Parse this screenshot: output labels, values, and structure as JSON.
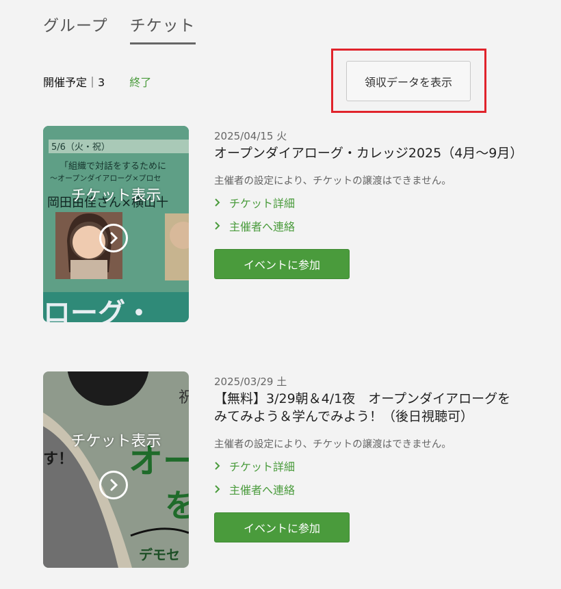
{
  "tabs": [
    {
      "label": "グループ"
    },
    {
      "label": "チケット"
    }
  ],
  "filters": {
    "upcoming": "開催予定｜3",
    "ended": "終了"
  },
  "receipt_button": "領収データを表示",
  "events": [
    {
      "thumb_label": "チケット表示",
      "thumb_text": {
        "date_banner": "5/6（火・祝）",
        "line1": "「組織で対話をするために",
        "line2": "～オープンダイアローグ×プロセ",
        "names": "岡田由佳さん×横山十",
        "bottom": "ローグ・"
      },
      "date": "2025/04/15 火",
      "title": "オープンダイアローグ・カレッジ2025（4月～9月）",
      "note": "主催者の設定により、チケットの譲渡はできません。",
      "link_detail": "チケット詳細",
      "link_contact": "主催者へ連絡",
      "join": "イベントに参加"
    },
    {
      "thumb_label": "チケット表示",
      "thumb_text": {
        "top_char": "祝",
        "big1": "オー",
        "big2": "を",
        "excl": "す！",
        "bottom": "デモセ"
      },
      "date": "2025/03/29 土",
      "title": "【無料】3/29朝＆4/1夜　オープンダイアローグをみてみよう＆学んでみよう！（後日視聴可）",
      "note": "主催者の設定により、チケットの譲渡はできません。",
      "link_detail": "チケット詳細",
      "link_contact": "主催者へ連絡",
      "join": "イベントに参加"
    }
  ],
  "colors": {
    "accent": "#4a9b3c",
    "highlight": "#e0232b",
    "thumb1_bg": "#2f8a78",
    "thumb2_bg": "#8f9a8c"
  }
}
